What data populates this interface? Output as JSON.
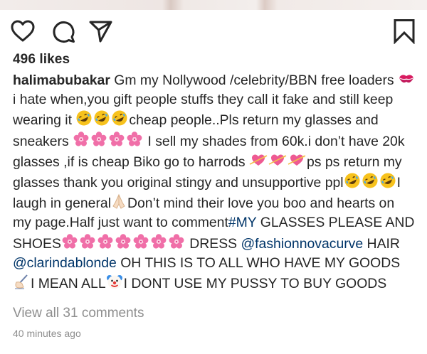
{
  "post": {
    "likes_text": "496 likes",
    "view_comments_text": "View all 31 comments",
    "timestamp": "40 minutes ago",
    "caption": [
      {
        "kind": "username",
        "text": "halimabubakar"
      },
      {
        "kind": "text",
        "text": " Gm my Nollywood /celebrity/BBN free loaders "
      },
      {
        "kind": "emoji",
        "icon": "kiss-lips-icon"
      },
      {
        "kind": "text",
        "text": "i hate when,you gift people stuffs they call it fake and still keep wearing it "
      },
      {
        "kind": "emoji",
        "icon": "rofl-face-icon"
      },
      {
        "kind": "emoji",
        "icon": "rofl-face-icon"
      },
      {
        "kind": "emoji",
        "icon": "rofl-face-icon"
      },
      {
        "kind": "text",
        "text": "cheap people..Pls return my glasses and sneakers "
      },
      {
        "kind": "emoji",
        "icon": "cherry-blossom-icon"
      },
      {
        "kind": "emoji",
        "icon": "cherry-blossom-icon"
      },
      {
        "kind": "emoji",
        "icon": "cherry-blossom-icon"
      },
      {
        "kind": "emoji",
        "icon": "cherry-blossom-icon"
      },
      {
        "kind": "text",
        "text": " I sell my shades from 60k.i don’t have 20k glasses ,if is cheap Biko go to harrods "
      },
      {
        "kind": "emoji",
        "icon": "heart-arrow-icon"
      },
      {
        "kind": "emoji",
        "icon": "heart-arrow-icon"
      },
      {
        "kind": "emoji",
        "icon": "heart-arrow-icon"
      },
      {
        "kind": "text",
        "text": "ps ps return my glasses thank you original stingy and unsupportive ppl"
      },
      {
        "kind": "emoji",
        "icon": "rofl-face-icon"
      },
      {
        "kind": "emoji",
        "icon": "rofl-face-icon"
      },
      {
        "kind": "emoji",
        "icon": "rofl-face-icon"
      },
      {
        "kind": "text",
        "text": "I laugh in general"
      },
      {
        "kind": "emoji",
        "icon": "folded-hands-icon"
      },
      {
        "kind": "text",
        "text": "Don’t mind their love you boo and hearts on my page.Half just want to comment"
      },
      {
        "kind": "tag",
        "text": "#MY"
      },
      {
        "kind": "text",
        "text": " GLASSES PLEASE AND SHOES"
      },
      {
        "kind": "emoji",
        "icon": "cherry-blossom-icon"
      },
      {
        "kind": "emoji",
        "icon": "cherry-blossom-icon"
      },
      {
        "kind": "emoji",
        "icon": "cherry-blossom-icon"
      },
      {
        "kind": "emoji",
        "icon": "cherry-blossom-icon"
      },
      {
        "kind": "emoji",
        "icon": "cherry-blossom-icon"
      },
      {
        "kind": "emoji",
        "icon": "cherry-blossom-icon"
      },
      {
        "kind": "emoji",
        "icon": "cherry-blossom-icon"
      },
      {
        "kind": "text",
        "text": " DRESS "
      },
      {
        "kind": "mention",
        "text": "@fashionnovacurve"
      },
      {
        "kind": "text",
        "text": " HAIR "
      },
      {
        "kind": "mention",
        "text": "@clarindablonde"
      },
      {
        "kind": "text",
        "text": " OH THIS IS TO ALL WHO HAVE MY GOODS"
      },
      {
        "kind": "emoji",
        "icon": "writing-hand-icon"
      },
      {
        "kind": "text",
        "text": "I MEAN ALL"
      },
      {
        "kind": "emoji",
        "icon": "clown-face-icon"
      },
      {
        "kind": "text",
        "text": "I DONT USE MY PUSSY TO BUY GOODS"
      }
    ]
  },
  "actions": {
    "icons": [
      "heart-icon",
      "comment-icon",
      "share-icon",
      "bookmark-icon"
    ]
  },
  "colors": {
    "text": "#262626",
    "link": "#003569",
    "muted": "#8e8e8e"
  }
}
